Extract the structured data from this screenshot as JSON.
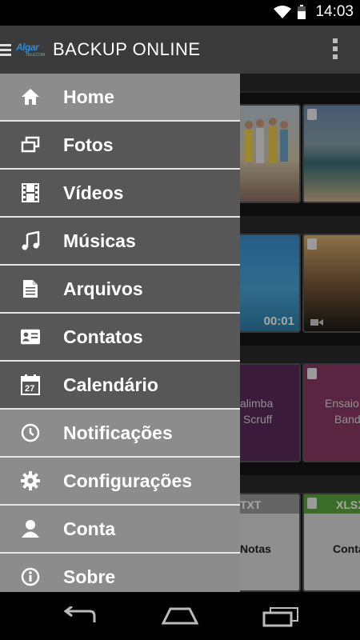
{
  "status": {
    "time": "14:03"
  },
  "appbar": {
    "logo_brand": "Algar",
    "logo_tag": "TELECOM",
    "title": "BACKUP ONLINE"
  },
  "drawer": {
    "items": [
      {
        "label": "Home",
        "icon": "home-icon"
      },
      {
        "label": "Fotos",
        "icon": "photos-icon"
      },
      {
        "label": "Vídeos",
        "icon": "film-icon"
      },
      {
        "label": "Músicas",
        "icon": "music-note-icon"
      },
      {
        "label": "Arquivos",
        "icon": "document-icon"
      },
      {
        "label": "Contatos",
        "icon": "contact-card-icon"
      },
      {
        "label": "Calendário",
        "icon": "calendar-icon"
      },
      {
        "label": "Notificações",
        "icon": "clock-icon"
      },
      {
        "label": "Configurações",
        "icon": "gear-icon"
      },
      {
        "label": "Conta",
        "icon": "person-icon"
      },
      {
        "label": "Sobre",
        "icon": "info-icon"
      }
    ],
    "calendar_day": "27"
  },
  "background": {
    "video_duration": "00:01",
    "music": [
      {
        "line1": "alimba",
        "line2": "Scruff"
      },
      {
        "line1": "Ensaio",
        "line2": "Band"
      }
    ],
    "files": [
      {
        "ext": "TXT",
        "name": "Notas"
      },
      {
        "ext": "XLSX",
        "name": "Conta"
      }
    ]
  },
  "colors": {
    "accent": "#2f8ad8",
    "drawer_light": "#8c8c8c",
    "drawer_dark": "#575757",
    "xlsx_green": "#5aa83e",
    "music_purple": "#5a2a5a",
    "music_pink": "#8a3a64"
  }
}
